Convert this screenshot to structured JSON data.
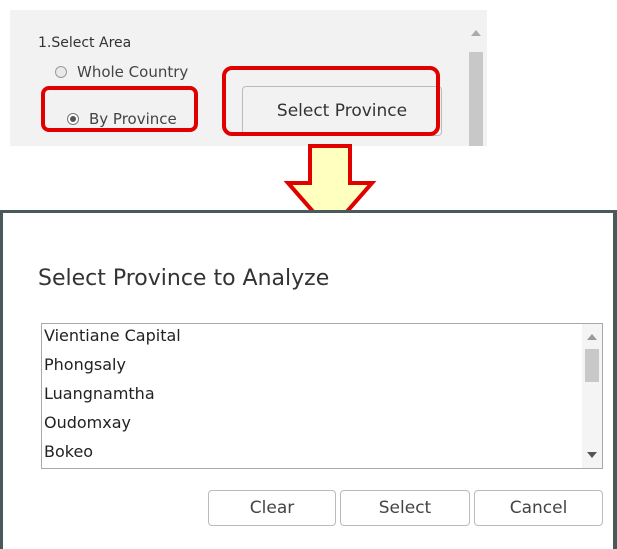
{
  "select_area": {
    "heading": "1.Select Area",
    "options": [
      {
        "label": "Whole Country",
        "checked": false
      },
      {
        "label": "By Province",
        "checked": true
      }
    ],
    "select_province_button": "Select Province"
  },
  "dialog": {
    "title": "Select Province to Analyze",
    "provinces": [
      "Vientiane Capital",
      "Phongsaly",
      "Luangnamtha",
      "Oudomxay",
      "Bokeo"
    ],
    "buttons": {
      "clear": "Clear",
      "select": "Select",
      "cancel": "Cancel"
    }
  },
  "colors": {
    "highlight": "#e00000",
    "arrow_fill": "#ffffc0",
    "dialog_border": "#4a5a5a"
  }
}
